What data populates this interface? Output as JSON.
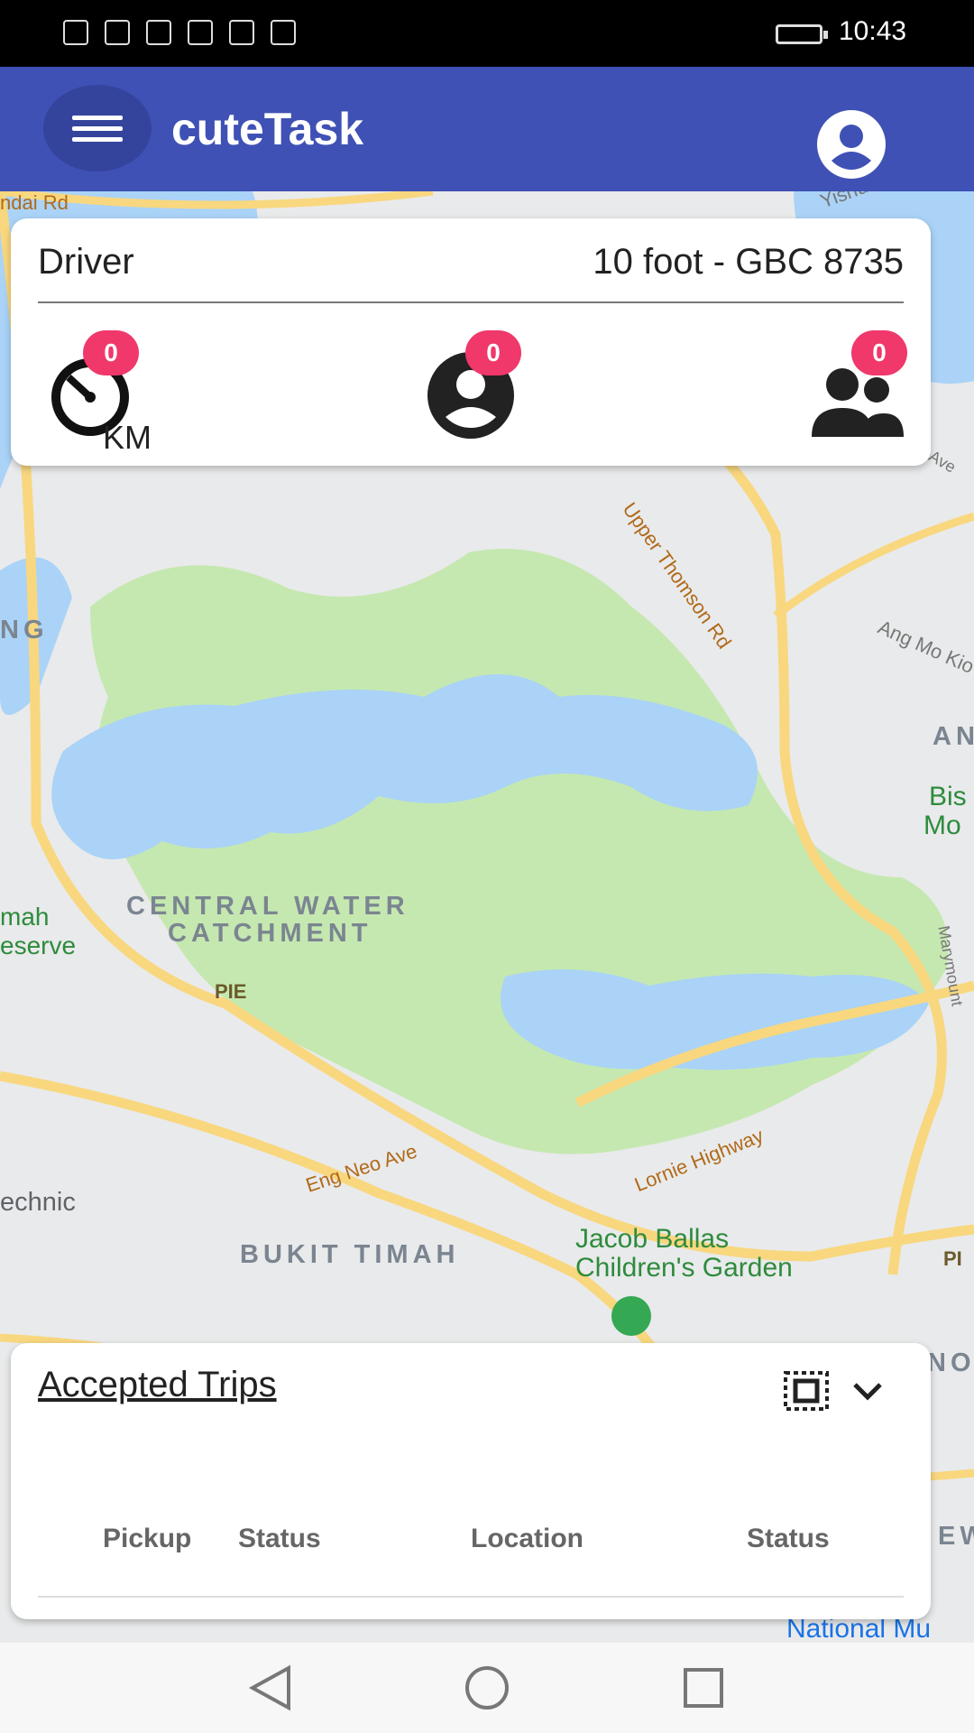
{
  "status_bar": {
    "time": "10:43"
  },
  "app_bar": {
    "title": "cuteTask"
  },
  "driver_card": {
    "role_label": "Driver",
    "vehicle_label": "10 foot - GBC 8735",
    "stats": [
      {
        "icon": "speedometer-icon",
        "count": "0",
        "unit": "KM"
      },
      {
        "icon": "person-icon",
        "count": "0"
      },
      {
        "icon": "group-icon",
        "count": "0"
      }
    ]
  },
  "map": {
    "labels": {
      "central": "CENTRAL WATER",
      "catchment": "CATCHMENT",
      "bukit_timah": "BUKIT TIMAH",
      "ng": "NG",
      "mah": "mah",
      "eserve": "eserve",
      "echnic": "echnic",
      "upper_thomson": "Upper Thomson Rd",
      "lornie": "Lornie Highway",
      "eng_neo": "Eng Neo Ave",
      "pie": "PIE",
      "ang_mo_kio": "Ang Mo Kio",
      "jacob1": "Jacob Ballas",
      "jacob2": "Children's Garden",
      "bis": "Bis",
      "mo": "Mo",
      "an": "AN",
      "national": "National Mu",
      "ndal_rd": "ndai Rd",
      "yishun": "Yishun",
      "no": "NO",
      "ew": "EW",
      "pi_right": "PI",
      "marymount": "Marymount",
      "r_ave": "r Ave"
    }
  },
  "trips_panel": {
    "title": "Accepted Trips",
    "columns": [
      "Pickup",
      "Status",
      "Location",
      "Status"
    ]
  },
  "colors": {
    "primary": "#3f51b5",
    "badge": "#f0386b",
    "water": "#aad3f7",
    "park": "#c5e8b0",
    "road": "#f8d77f"
  }
}
